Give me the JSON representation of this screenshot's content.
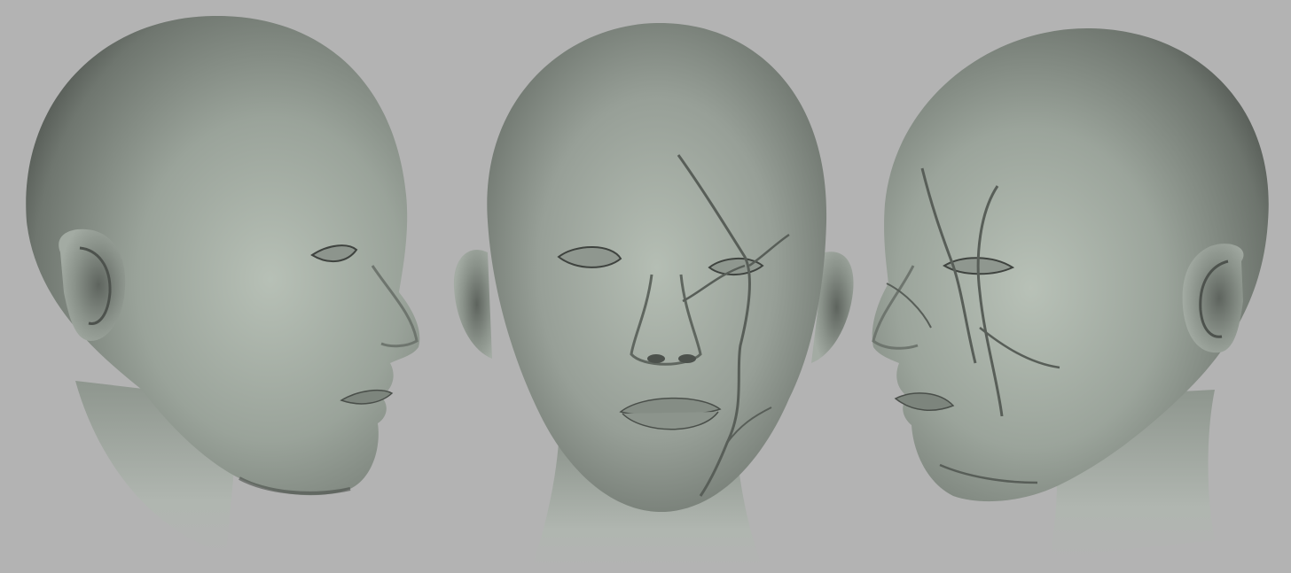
{
  "scene": {
    "background_color": "#b3b3b3",
    "material_color": "#9aa39a",
    "views": [
      {
        "id": "left-profile",
        "facing": "right",
        "has_scars": false
      },
      {
        "id": "front",
        "facing": "viewer",
        "has_scars": true
      },
      {
        "id": "right-three-quarter",
        "facing": "left",
        "has_scars": true
      }
    ]
  }
}
